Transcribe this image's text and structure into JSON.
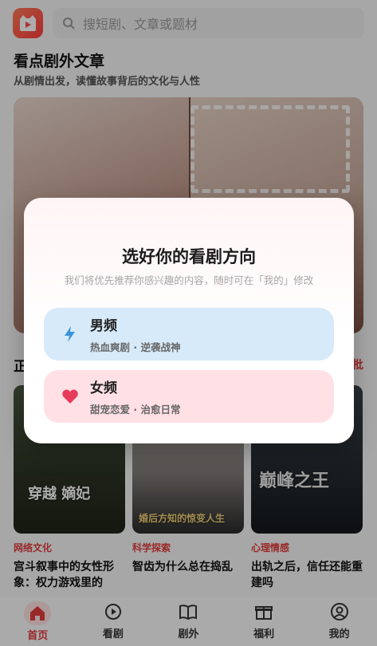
{
  "header": {
    "search_placeholder": "搜短剧、文章或题材"
  },
  "article_section": {
    "title": "看点剧外文章",
    "subtitle": "从剧情出发，读懂故事背后的文化与人性"
  },
  "hot_section": {
    "title_partial": "正",
    "more_partial": "批"
  },
  "cards": [
    {
      "tag": "网络文化",
      "title": "宫斗叙事中的女性形象：权力游戏里的生...",
      "thumb_caption": "穿越 嫡妃"
    },
    {
      "tag": "科学探索",
      "title": "智齿为什么总在捣乱",
      "thumb_caption": "婚后方知的惊变人生"
    },
    {
      "tag": "心理情感",
      "title": "出轨之后，信任还能重建吗",
      "thumb_caption": "巅峰之王"
    }
  ],
  "modal": {
    "title": "选好你的看剧方向",
    "description": "我们将优先推荐你感兴趣的内容，随时可在「我的」修改",
    "options": [
      {
        "title": "男频",
        "subtitle": "热血爽剧 · 逆袭战神",
        "icon": "lightning-icon",
        "color": "#d7eaf9",
        "icon_color": "#3d93d8"
      },
      {
        "title": "女频",
        "subtitle": "甜宠恋爱 · 治愈日常",
        "icon": "heart-icon",
        "color": "#ffe0e5",
        "icon_color": "#e63c5c"
      }
    ]
  },
  "tabbar": {
    "items": [
      {
        "label": "首页",
        "icon": "home-icon",
        "active": true
      },
      {
        "label": "看剧",
        "icon": "play-circle-icon",
        "active": false
      },
      {
        "label": "剧外",
        "icon": "book-icon",
        "active": false
      },
      {
        "label": "福利",
        "icon": "gift-icon",
        "active": false
      },
      {
        "label": "我的",
        "icon": "user-icon",
        "active": false
      }
    ]
  },
  "colors": {
    "accent": "#e23b3b",
    "overlay": "rgba(0,0,0,0.32)"
  }
}
